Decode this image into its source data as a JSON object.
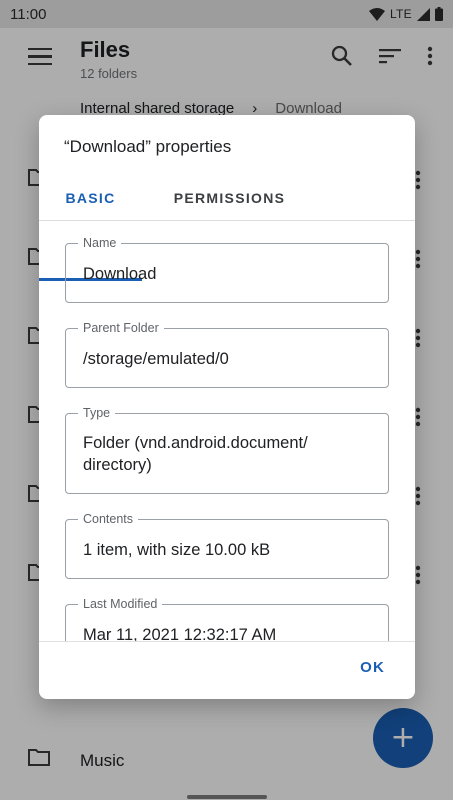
{
  "status_bar": {
    "time": "11:00",
    "network": "LTE"
  },
  "app_bar": {
    "title": "Files",
    "subtitle": "12 folders"
  },
  "breadcrumb": {
    "root": "Internal shared storage",
    "current": "Download"
  },
  "folders": {
    "last_visible": "Music"
  },
  "colors": {
    "accent": "#1a5fb4",
    "fab": "#1a5fb4"
  },
  "dialog": {
    "title": "“Download” properties",
    "tabs": [
      {
        "label": "BASIC",
        "selected": true
      },
      {
        "label": "PERMISSIONS",
        "selected": false
      }
    ],
    "fields": {
      "name": {
        "label": "Name",
        "value": "Download"
      },
      "parent": {
        "label": "Parent Folder",
        "value": "/storage/emulated/0"
      },
      "type": {
        "label": "Type",
        "value_line1": "Folder (vnd.android.document/",
        "value_line2": "directory)"
      },
      "contents": {
        "label": "Contents",
        "value": "1 item, with size 10.00 kB"
      },
      "modified": {
        "label": "Last Modified",
        "value": "Mar 11, 2021 12:32:17 AM"
      }
    },
    "ok_label": "OK"
  }
}
